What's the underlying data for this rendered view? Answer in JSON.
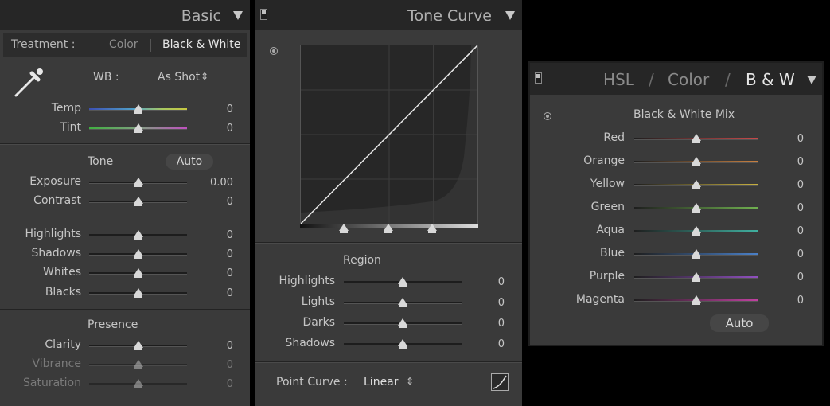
{
  "basic": {
    "title": "Basic",
    "treatment_label": "Treatment :",
    "treatment_color": "Color",
    "treatment_bw": "Black & White",
    "wb_label": "WB :",
    "wb_value": "As Shot",
    "wb_arrows": "⇕",
    "temp": {
      "label": "Temp",
      "value": "0",
      "level": 0.5
    },
    "tint": {
      "label": "Tint",
      "value": "0",
      "level": 0.5
    },
    "tone_label": "Tone",
    "auto_label": "Auto",
    "exposure": {
      "label": "Exposure",
      "value": "0.00",
      "level": 0.5
    },
    "contrast": {
      "label": "Contrast",
      "value": "0",
      "level": 0.5
    },
    "highlights": {
      "label": "Highlights",
      "value": "0",
      "level": 0.5
    },
    "shadows": {
      "label": "Shadows",
      "value": "0",
      "level": 0.5
    },
    "whites": {
      "label": "Whites",
      "value": "0",
      "level": 0.5
    },
    "blacks": {
      "label": "Blacks",
      "value": "0",
      "level": 0.5
    },
    "presence_label": "Presence",
    "clarity": {
      "label": "Clarity",
      "value": "0",
      "level": 0.5
    },
    "vibrance": {
      "label": "Vibrance",
      "value": "0",
      "level": 0.5
    },
    "saturation": {
      "label": "Saturation",
      "value": "0",
      "level": 0.5
    }
  },
  "tone_curve": {
    "title": "Tone Curve",
    "region_label": "Region",
    "highlights": {
      "label": "Highlights",
      "value": "0",
      "level": 0.5
    },
    "lights": {
      "label": "Lights",
      "value": "0",
      "level": 0.5
    },
    "darks": {
      "label": "Darks",
      "value": "0",
      "level": 0.5
    },
    "shadows": {
      "label": "Shadows",
      "value": "0",
      "level": 0.5
    },
    "point_curve_label": "Point Curve :",
    "point_curve_value": "Linear",
    "point_curve_arrows": "⇕"
  },
  "hsl": {
    "tab_hsl": "HSL",
    "sep1": "/",
    "tab_color": "Color",
    "sep2": "/",
    "tab_bw": "B & W",
    "mix_title": "Black & White Mix",
    "red": {
      "label": "Red",
      "value": "0",
      "level": 0.5
    },
    "orange": {
      "label": "Orange",
      "value": "0",
      "level": 0.5
    },
    "yellow": {
      "label": "Yellow",
      "value": "0",
      "level": 0.5
    },
    "green": {
      "label": "Green",
      "value": "0",
      "level": 0.5
    },
    "aqua": {
      "label": "Aqua",
      "value": "0",
      "level": 0.5
    },
    "blue": {
      "label": "Blue",
      "value": "0",
      "level": 0.5
    },
    "purple": {
      "label": "Purple",
      "value": "0",
      "level": 0.5
    },
    "magenta": {
      "label": "Magenta",
      "value": "0",
      "level": 0.5
    },
    "auto_label": "Auto"
  },
  "colors": {
    "panel_bg": "#3a3a3a",
    "header_bg": "#262626",
    "text": "#c6c6c6",
    "red": "#c84a4a",
    "orange": "#c88040",
    "yellow": "#c8b040",
    "green": "#70b050",
    "aqua": "#40b0a0",
    "blue": "#4a80c8",
    "purple": "#9050c0",
    "magenta": "#c040a0"
  }
}
